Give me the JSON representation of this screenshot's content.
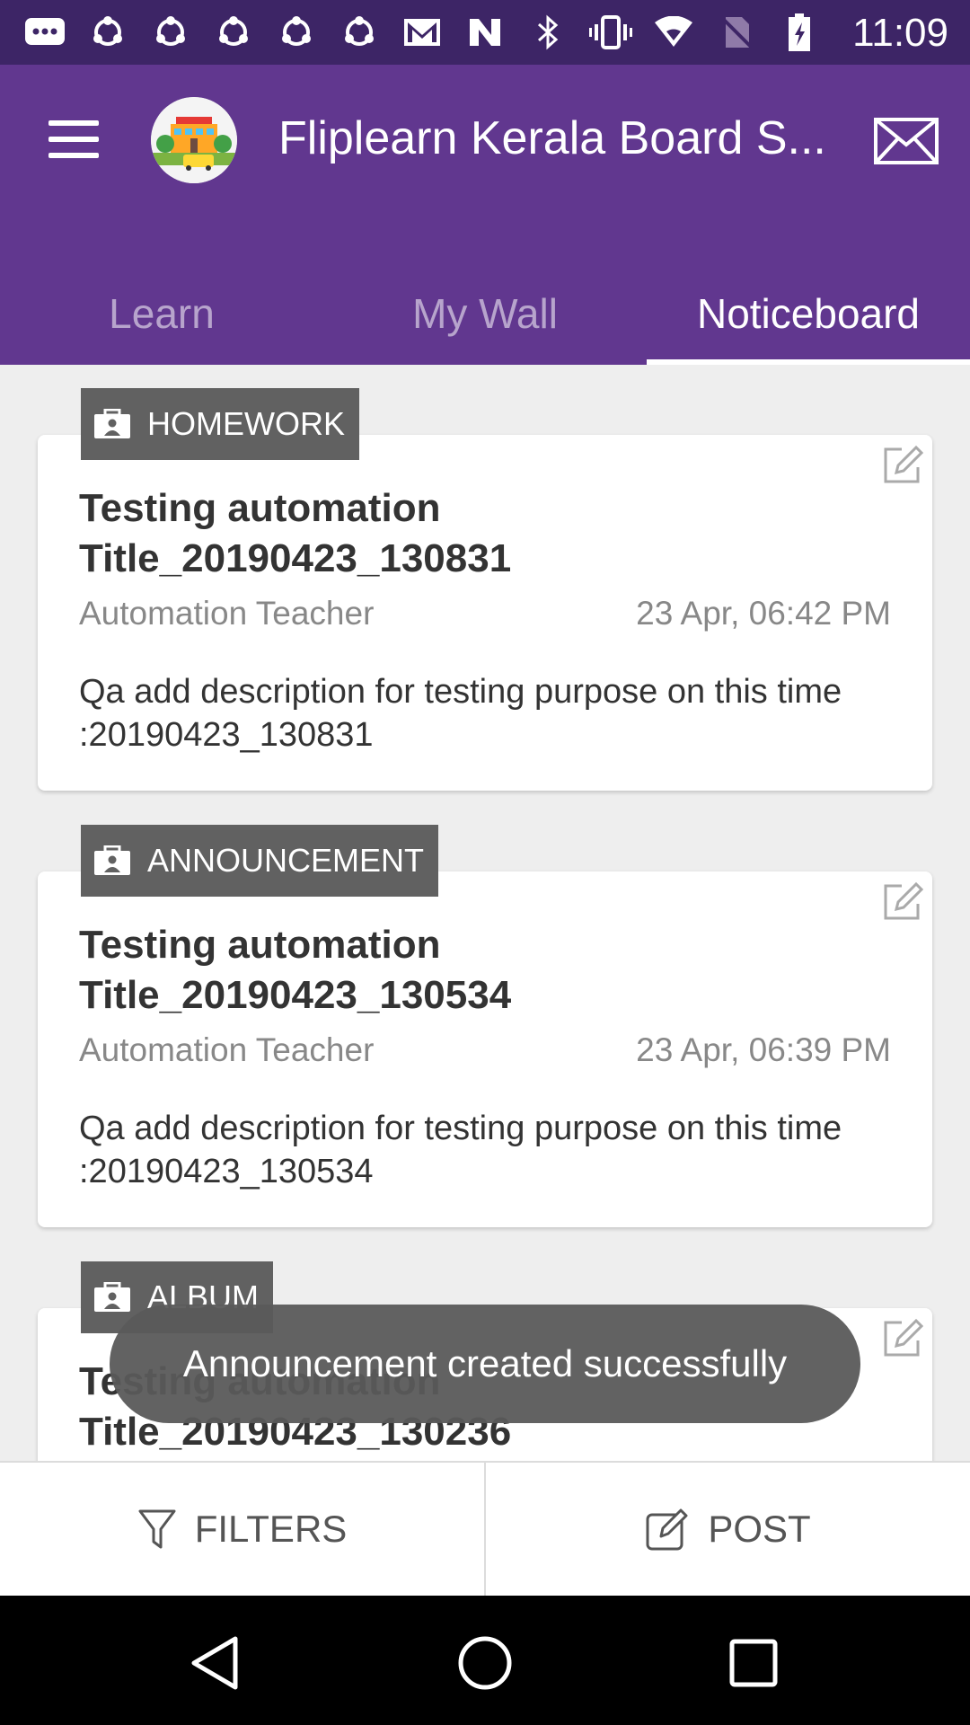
{
  "status_bar": {
    "time": "11:09",
    "icons": [
      "message-icon",
      "sync-icon",
      "sync-icon",
      "sync-icon",
      "sync-icon",
      "sync-icon",
      "gmail-icon",
      "n-icon",
      "bluetooth-icon",
      "vibrate-icon",
      "wifi-icon",
      "no-sim-icon",
      "battery-icon"
    ]
  },
  "header": {
    "title": "Fliplearn Kerala Board S...",
    "tabs": [
      {
        "label": "Learn"
      },
      {
        "label": "My Wall"
      },
      {
        "label": "Noticeboard"
      }
    ],
    "active_tab": "Noticeboard"
  },
  "feed": [
    {
      "tag": "HOMEWORK",
      "title": "Testing automation Title_20190423_130831",
      "author": "Automation Teacher",
      "date": "23 Apr, 06:42 PM",
      "description": "Qa add description for testing purpose on this time :20190423_130831"
    },
    {
      "tag": "ANNOUNCEMENT",
      "title": "Testing automation Title_20190423_130534",
      "author": "Automation Teacher",
      "date": "23 Apr, 06:39 PM",
      "description": "Qa add description for testing purpose on this time :20190423_130534"
    },
    {
      "tag": "ALBUM",
      "title": "Testing automation Title_20190423_130236",
      "author": "",
      "date": "",
      "description": ""
    }
  ],
  "toast": "Announcement created successfully",
  "bottom_bar": {
    "filters_label": "FILTERS",
    "post_label": "POST"
  },
  "colors": {
    "status_bar": "#3d2566",
    "app_bar": "#61378f",
    "tag": "#616161",
    "background": "#eeeeee"
  }
}
